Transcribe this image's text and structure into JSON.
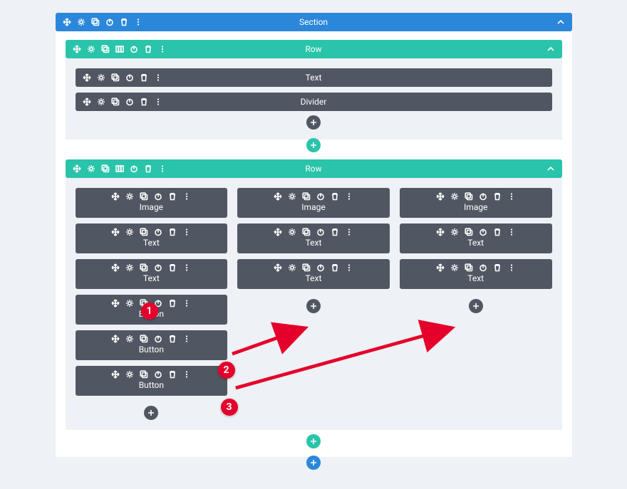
{
  "colors": {
    "section": "#2b87da",
    "row": "#29c4a9",
    "module": "#515762",
    "annotation": "#e4002b",
    "canvas_bg": "#eef1f5"
  },
  "icons": {
    "move": "move-icon",
    "gear": "gear-icon",
    "duplicate": "duplicate-icon",
    "columns": "columns-icon",
    "power": "power-icon",
    "trash": "trash-icon",
    "more": "more-icon",
    "collapse": "chevron-up-icon",
    "add": "plus-icon"
  },
  "section": {
    "label": "Section",
    "rows": [
      {
        "label": "Row",
        "has_columns_icon": true,
        "columns": [
          {
            "modules": [
              {
                "label": "Text"
              },
              {
                "label": "Divider"
              }
            ]
          }
        ]
      },
      {
        "label": "Row",
        "has_columns_icon": true,
        "columns": [
          {
            "modules": [
              {
                "label": "Image"
              },
              {
                "label": "Text"
              },
              {
                "label": "Text"
              },
              {
                "label": "Button"
              },
              {
                "label": "Button"
              },
              {
                "label": "Button"
              }
            ]
          },
          {
            "modules": [
              {
                "label": "Image"
              },
              {
                "label": "Text"
              },
              {
                "label": "Text"
              }
            ]
          },
          {
            "modules": [
              {
                "label": "Image"
              },
              {
                "label": "Text"
              },
              {
                "label": "Text"
              }
            ]
          }
        ]
      }
    ]
  },
  "annotations": {
    "badges": [
      "1",
      "2",
      "3"
    ]
  }
}
